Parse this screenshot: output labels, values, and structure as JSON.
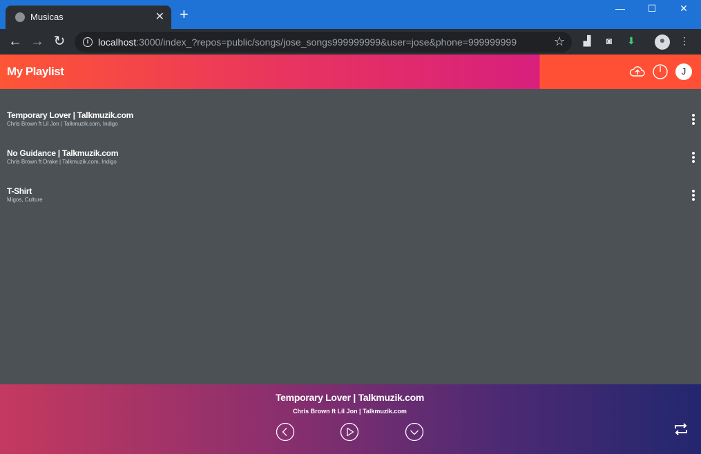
{
  "browser": {
    "tab_title": "Musicas",
    "url_host": "localhost",
    "url_rest": ":3000/index_?repos=public/songs/jose_songs999999999&user=jose&phone=999999999"
  },
  "header": {
    "title": "My Playlist",
    "avatar_letter": "J"
  },
  "songs": [
    {
      "title": "Temporary Lover | Talkmuzik.com",
      "subtitle": "Chris Brown ft Lil Jon | Talkmuzik.com, Indigo"
    },
    {
      "title": "No Guidance | Talkmuzik.com",
      "subtitle": "Chris Brown ft Drake | Talkmuzik.com, Indigo"
    },
    {
      "title": "T-Shirt",
      "subtitle": "Migos, Culture"
    }
  ],
  "player": {
    "title": "Temporary Lover | Talkmuzik.com",
    "artist": "Chris Brown ft Lil Jon | Talkmuzik.com"
  },
  "colors": {
    "header_start": "#ff5535",
    "header_end": "#d81f7d",
    "background": "#4b5155",
    "player_start": "#c4395f",
    "player_end": "#22276f"
  },
  "icons": {
    "upload": "cloud-upload-icon",
    "power": "power-icon",
    "song_menu": "more-vertical-icon",
    "prev": "chevron-left-circle-icon",
    "play": "play-circle-icon",
    "next": "chevron-down-circle-icon",
    "repeat": "repeat-icon"
  }
}
